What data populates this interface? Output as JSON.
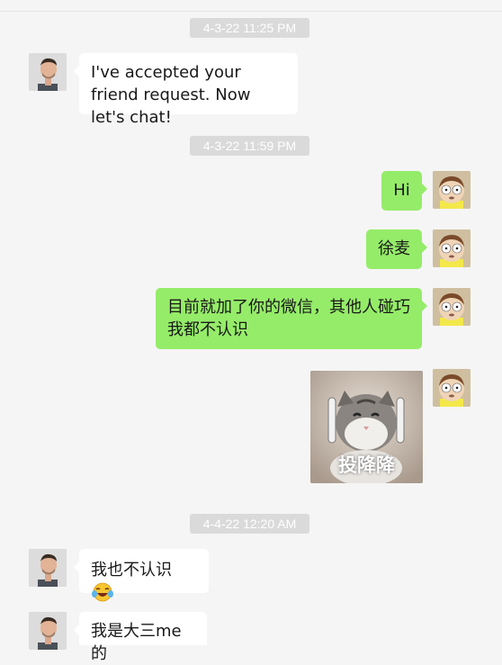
{
  "colors": {
    "background": "#f5f5f5",
    "timestamp_bg": "#dadada",
    "incoming_bubble": "#ffffff",
    "outgoing_bubble": "#95ec69",
    "text": "#191919"
  },
  "messages": [
    {
      "type": "timestamp",
      "text": "4-3-22 11:25 PM"
    },
    {
      "type": "incoming",
      "sender": "contact",
      "text": "I've accepted your friend request. Now let's chat!"
    },
    {
      "type": "timestamp",
      "text": "4-3-22 11:59 PM"
    },
    {
      "type": "outgoing",
      "sender": "me",
      "text": "Hi"
    },
    {
      "type": "outgoing",
      "sender": "me",
      "text": "徐麦"
    },
    {
      "type": "outgoing",
      "sender": "me",
      "text": "目前就加了你的微信，其他人碰巧我都不认识"
    },
    {
      "type": "outgoing-sticker",
      "sender": "me",
      "sticker": "cat-surrender-sticker",
      "text": "投降降"
    },
    {
      "type": "timestamp",
      "text": "4-4-22 12:20 AM"
    },
    {
      "type": "incoming",
      "sender": "contact",
      "text": "我也不认识",
      "emoji": "laughing-tears-emoji"
    },
    {
      "type": "incoming",
      "sender": "contact",
      "text": "我是大三me的"
    }
  ],
  "avatars": {
    "contact": "contact-avatar-man-photo",
    "me": "cartoon-morty-avatar"
  }
}
